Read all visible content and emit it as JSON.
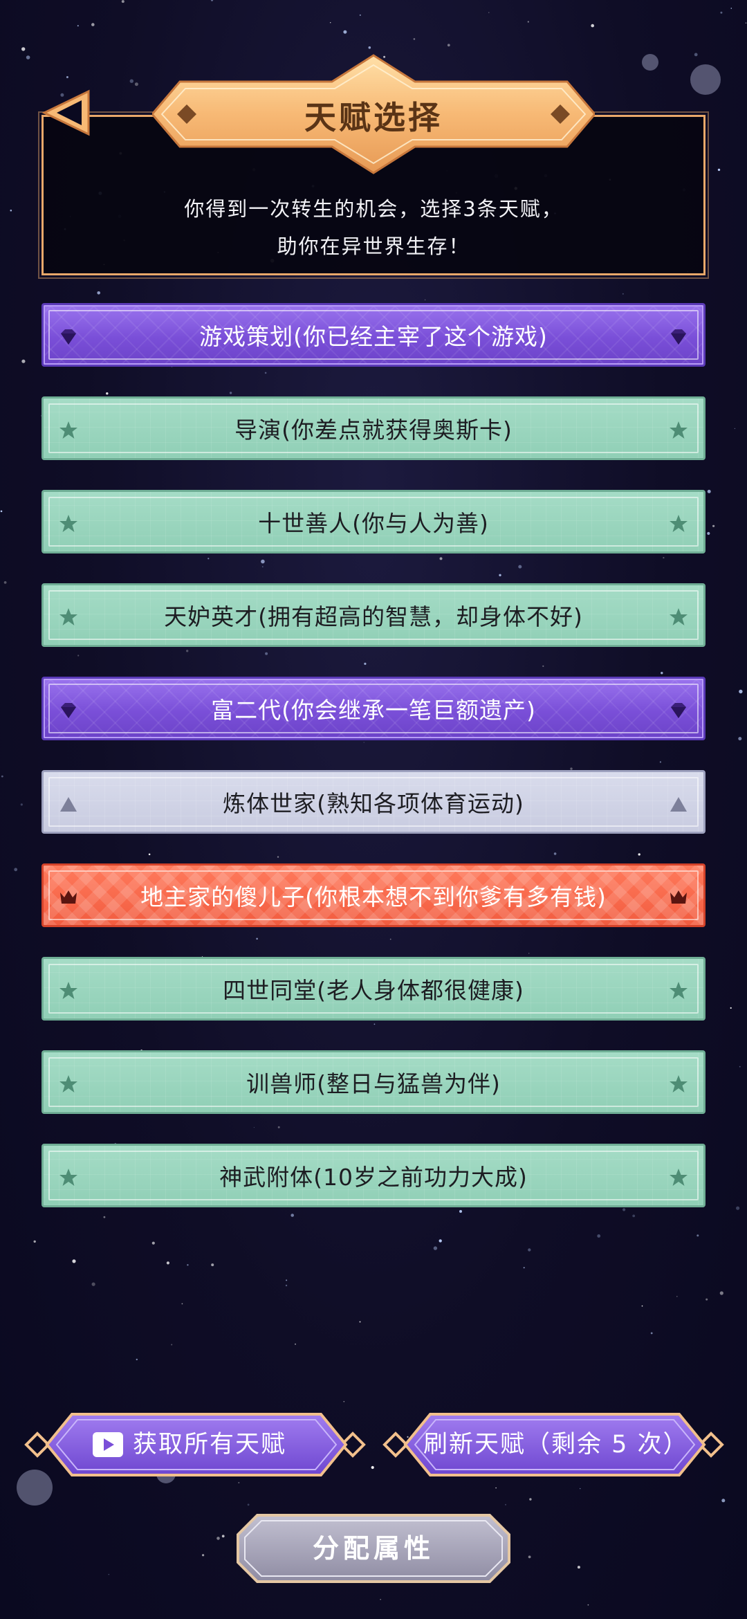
{
  "header": {
    "title": "天赋选择",
    "intro": "你得到一次转生的机会，选择3条天赋，\n助你在异世界生存！"
  },
  "talents": [
    {
      "label": "游戏策划(你已经主宰了这个游戏)",
      "rarity": "purple",
      "icon": "diamond-icon"
    },
    {
      "label": "导演(你差点就获得奥斯卡)",
      "rarity": "green",
      "icon": "star-icon"
    },
    {
      "label": "十世善人(你与人为善)",
      "rarity": "green",
      "icon": "star-icon"
    },
    {
      "label": "天妒英才(拥有超高的智慧，却身体不好)",
      "rarity": "green",
      "icon": "star-icon"
    },
    {
      "label": "富二代(你会继承一笔巨额遗产)",
      "rarity": "purple",
      "icon": "diamond-icon"
    },
    {
      "label": "炼体世家(熟知各项体育运动)",
      "rarity": "white",
      "icon": "triangle-icon"
    },
    {
      "label": "地主家的傻儿子(你根本想不到你爹有多有钱)",
      "rarity": "orange",
      "icon": "crown-icon"
    },
    {
      "label": "四世同堂(老人身体都很健康)",
      "rarity": "green",
      "icon": "star-icon"
    },
    {
      "label": "训兽师(整日与猛兽为伴)",
      "rarity": "green",
      "icon": "star-icon"
    },
    {
      "label": "神武附体(10岁之前功力大成)",
      "rarity": "green",
      "icon": "star-icon"
    }
  ],
  "buttons": {
    "get_all": "获取所有天赋",
    "refresh": "刷新天赋（剩余 5 次）",
    "allocate": "分配属性"
  },
  "colors": {
    "panel_border": "#e9a86a",
    "title_banner": "#f7b975",
    "purple": "#7a4fd8",
    "green": "#9bd6be",
    "white": "#d2d5e7",
    "orange": "#f25c3f",
    "button_purple": "#8a63e6",
    "button_grey": "#a9a7b8"
  }
}
